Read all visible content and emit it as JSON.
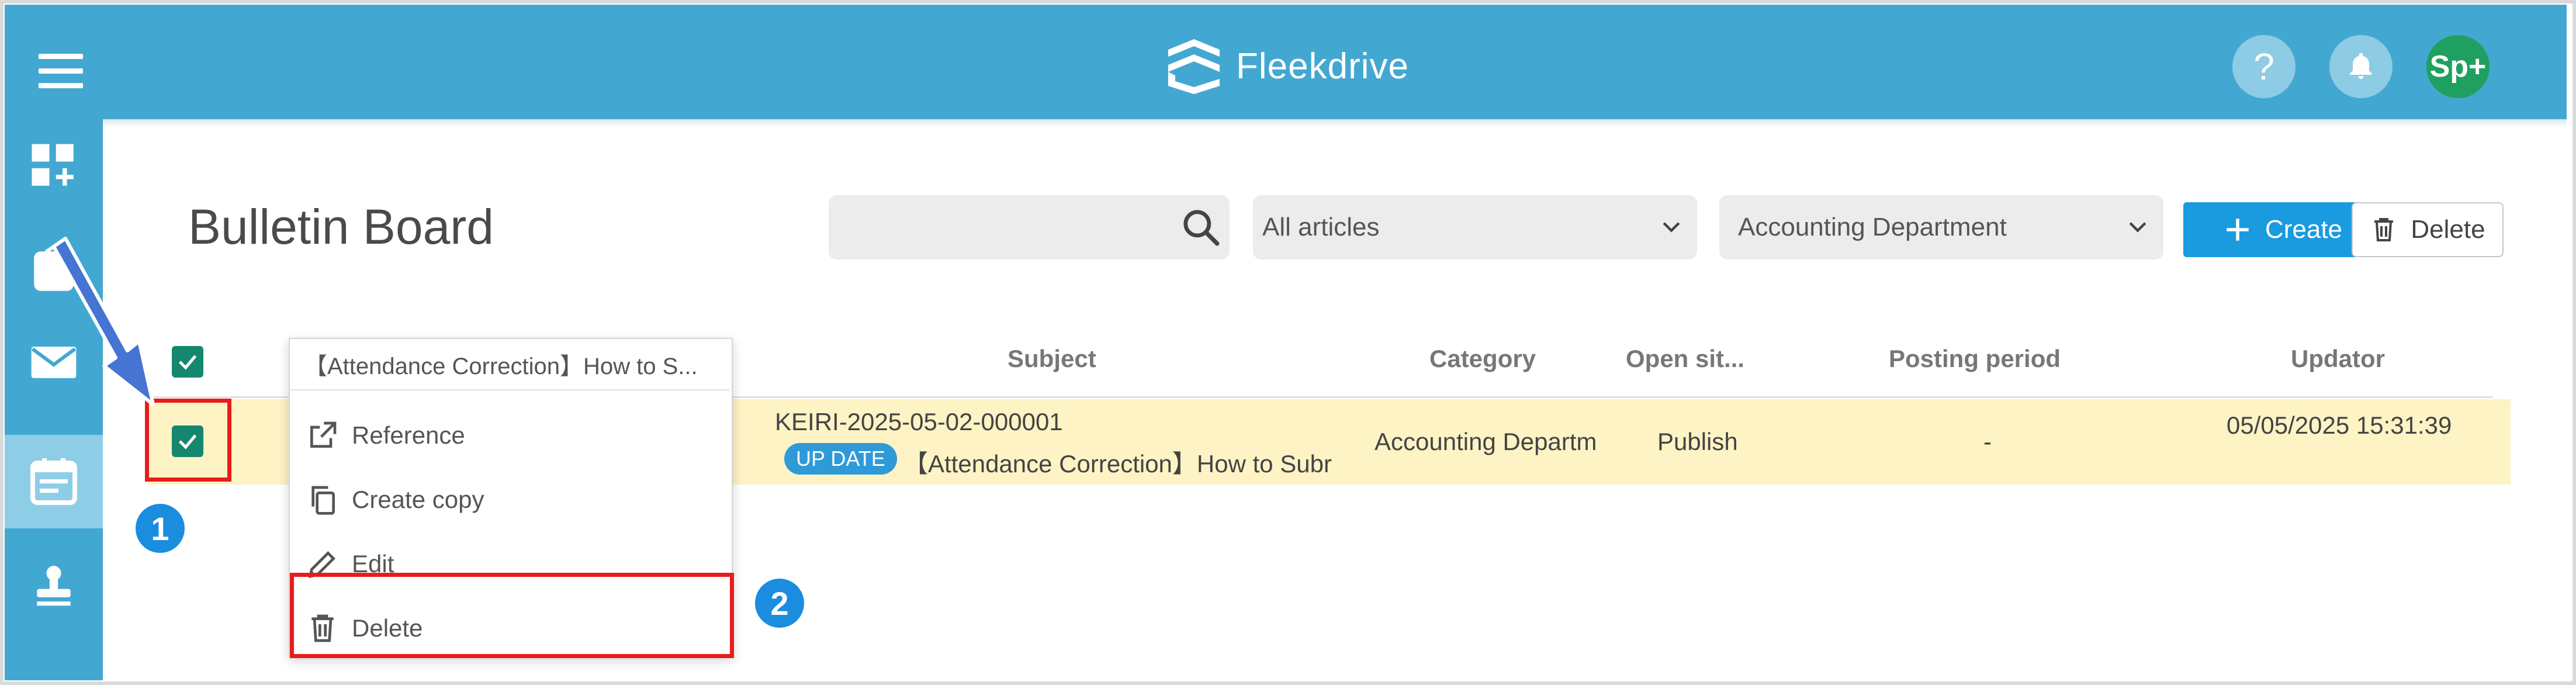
{
  "app": {
    "name": "Fleekdrive",
    "avatar": "Sp+",
    "help": "?"
  },
  "page": {
    "title": "Bulletin Board"
  },
  "toolbar": {
    "search_placeholder": "",
    "filter_selected": "All articles",
    "department_selected": "Accounting Department",
    "create_label": "Create",
    "delete_label": "Delete"
  },
  "table": {
    "columns": [
      "Subject",
      "Category",
      "Open sit...",
      "Posting period",
      "Updator"
    ],
    "rows": [
      {
        "id": "KEIRI-2025-05-02-000001",
        "badge": "UP DATE",
        "subject": "【Attendance Correction】How to Subr",
        "category": "Accounting Departm",
        "open_site": "Publish",
        "posting_period": "-",
        "updated": "05/05/2025 15:31:39"
      }
    ]
  },
  "context_menu": {
    "title": "【Attendance Correction】How to S...",
    "items": [
      "Reference",
      "Create copy",
      "Edit",
      "Delete"
    ]
  },
  "steps": [
    "1",
    "2"
  ],
  "colors": {
    "header": "#43a8d1",
    "primary": "#1a9be0",
    "checkbox": "#15876e",
    "highlight": "#e81c1c",
    "row": "#fdf3c4"
  }
}
